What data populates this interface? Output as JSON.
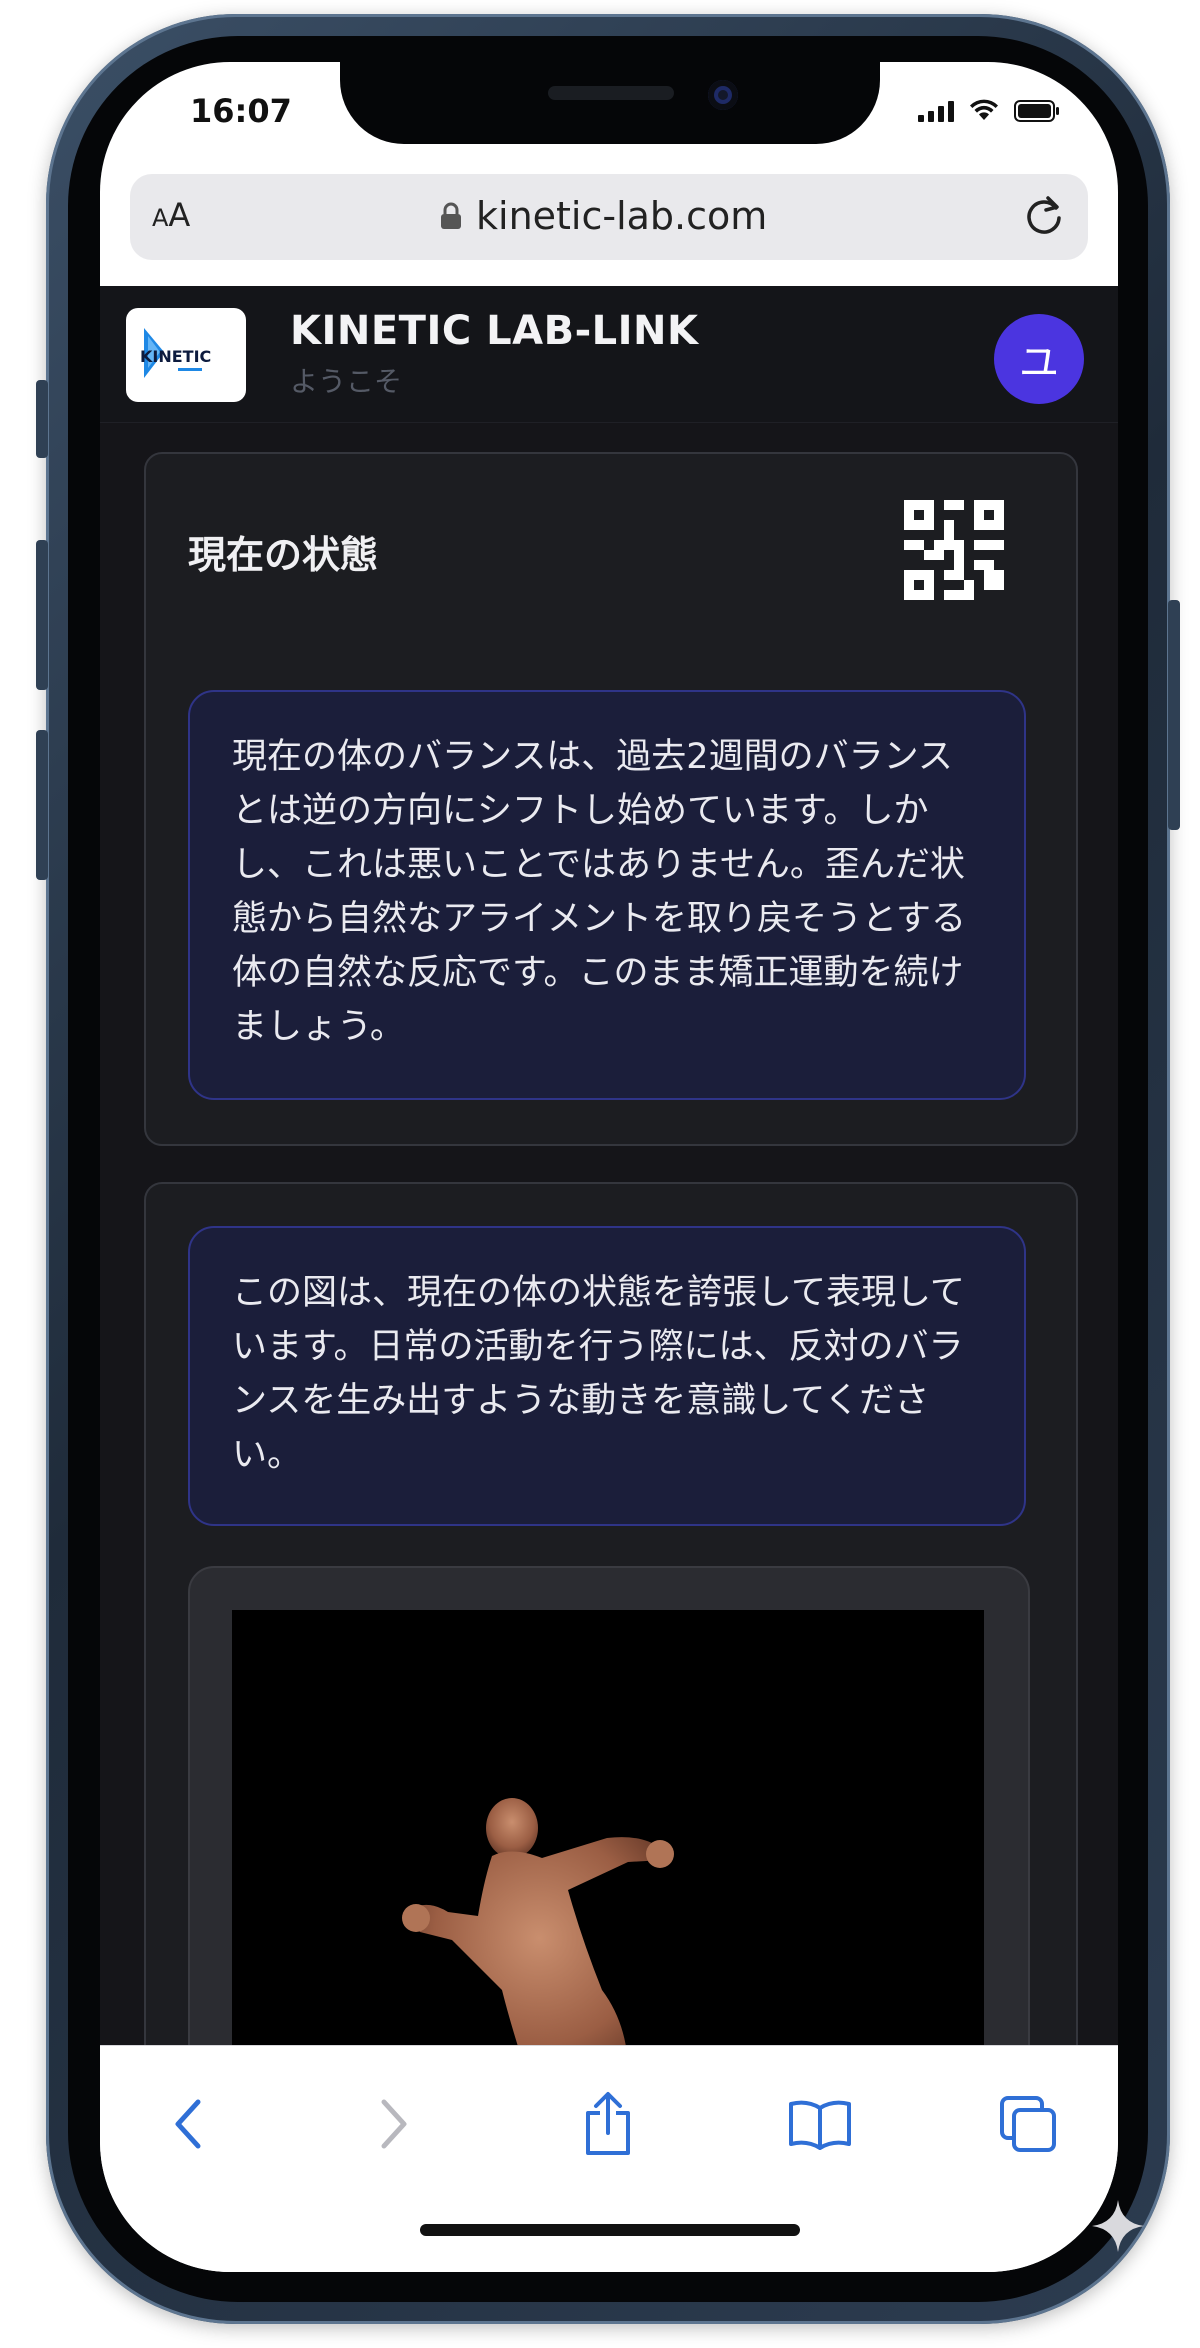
{
  "status_bar": {
    "time": "16:07"
  },
  "browser": {
    "text_size_label_small": "A",
    "text_size_label_large": "A",
    "url": "kinetic-lab.com"
  },
  "app_header": {
    "logo_text": "KINETIC",
    "title": "KINETIC LAB-LINK",
    "subtitle": "ようこそ",
    "avatar_initial": "ユ"
  },
  "status_card": {
    "title": "現在の状態",
    "message": "現在の体のバランスは、過去2週間のバランスとは逆の方向にシフトし始めています。しかし、これは悪いことではありません。歪んだ状態から自然なアライメントを取り戻そうとする体の自然な反応です。このまま矯正運動を続けましょう。"
  },
  "figure_card": {
    "message": "この図は、現在の体の状態を誇張して表現しています。日常の活動を行う際には、反対のバランスを生み出すような動きを意識してください。"
  },
  "toolbar": {
    "icons": [
      "chevron-left-icon",
      "chevron-right-icon",
      "share-icon",
      "book-icon",
      "tabs-icon"
    ]
  },
  "colors": {
    "page_background": "#151519",
    "card_background": "#1c1d21",
    "message_background": "#1b1e3a",
    "message_border": "#2f3488",
    "avatar": "#4b35e0",
    "browser_accent": "#2f6fd6"
  }
}
